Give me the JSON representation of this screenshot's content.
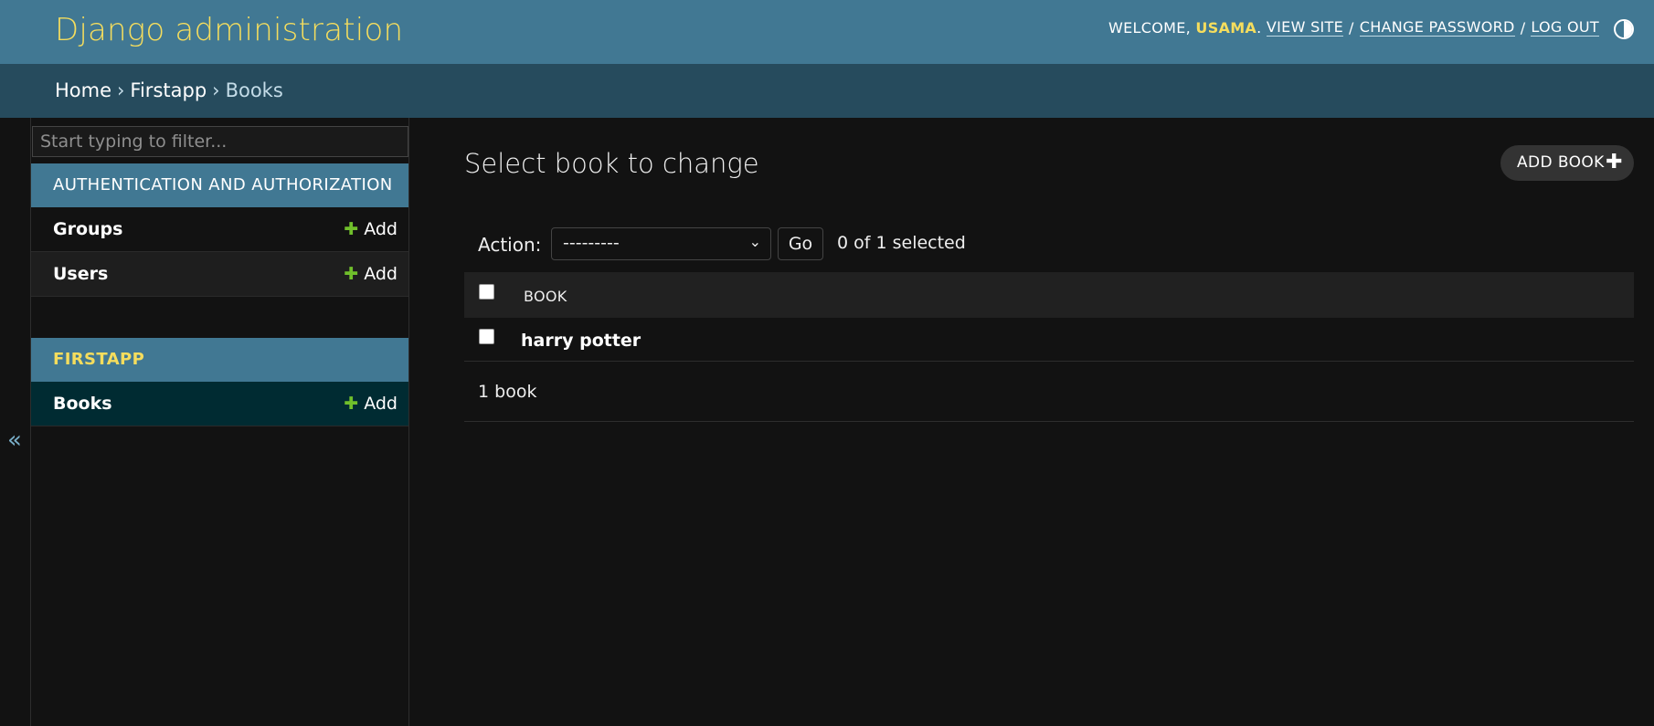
{
  "header": {
    "brand": "Django administration",
    "welcome": "WELCOME,",
    "user_name": "USAMA",
    "name_suffix": ".",
    "view_site": "VIEW SITE",
    "change_password": "CHANGE PASSWORD",
    "log_out": "LOG OUT",
    "separator": "/"
  },
  "breadcrumbs": {
    "home": "Home",
    "app": "Firstapp",
    "current": "Books",
    "separator": "›"
  },
  "sidebar": {
    "filter_placeholder": "Start typing to filter...",
    "collapse_glyph": "«",
    "apps": [
      {
        "caption": "AUTHENTICATION AND AUTHORIZATION",
        "models": [
          {
            "name": "Groups",
            "add": "Add"
          },
          {
            "name": "Users",
            "add": "Add"
          }
        ]
      },
      {
        "caption": "FIRSTAPP",
        "models": [
          {
            "name": "Books",
            "add": "Add"
          }
        ]
      }
    ],
    "add_glyph": "✚"
  },
  "main": {
    "title": "Select book to change",
    "add_button": "ADD BOOK",
    "add_glyph": "✚",
    "action_label": "Action:",
    "action_value": "---------",
    "go_label": "Go",
    "counter": "0 of 1 selected",
    "table": {
      "column": "BOOK",
      "rows": [
        {
          "title": "harry potter"
        }
      ]
    },
    "paginator": "1 book"
  },
  "colors": {
    "header_bg": "#417893",
    "brand": "#f5dd5d",
    "breadcrumbs_bg": "#264b5d",
    "accent_add": "#70bf2b",
    "active_row": "#002b32"
  }
}
